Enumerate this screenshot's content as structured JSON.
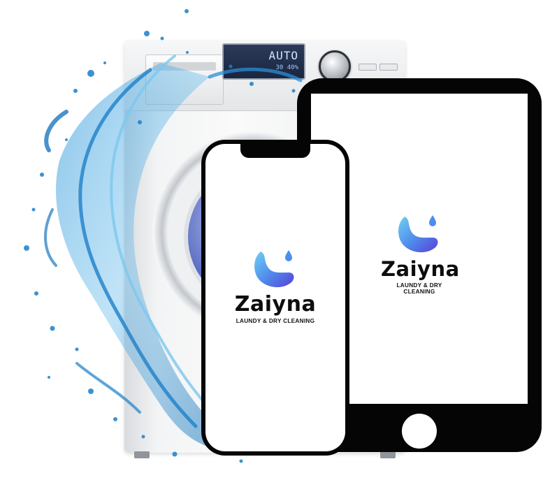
{
  "washer": {
    "display_mode": "AUTO",
    "display_readout": "30 40%"
  },
  "brand": {
    "name": "Zaiyna",
    "tagline": "LAUNDY & DRY CLEANING",
    "colors": {
      "drop_light": "#63c7f2",
      "drop_dark": "#5a3fd6",
      "wordmark": "#0d0d0d",
      "device_frame": "#050505"
    }
  },
  "icons": [
    "logo-mark-icon",
    "water-drop-icon",
    "home-button-icon"
  ]
}
